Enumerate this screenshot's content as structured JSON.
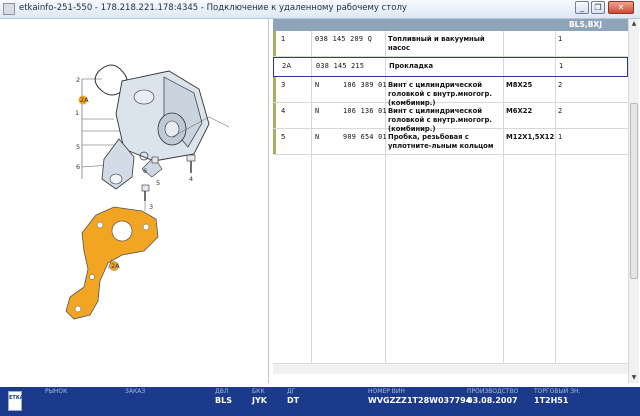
{
  "window": {
    "title": "etkainfo-251-550 - 178.218.221.178:4345 - Подключение к удаленному рабочему столу",
    "buttons": {
      "minimize": "_",
      "restore": "❐",
      "close": "✕"
    }
  },
  "illustration": {
    "callouts": [
      "1",
      "2",
      "2A",
      "3",
      "4",
      "5",
      "6"
    ]
  },
  "parts_table": {
    "header_right": "BLS,BXJ",
    "rows": [
      {
        "pos": "1",
        "mark": "",
        "part_number": "038 145 209 Q",
        "description": "Топливный и вакуумный насос",
        "spec": "",
        "qty": "1"
      },
      {
        "pos": "2A",
        "mark": "",
        "part_number": "038 145 215",
        "description": "Прокладка",
        "spec": "",
        "qty": "1"
      },
      {
        "pos": "3",
        "mark": "N",
        "part_number": "106 389 01",
        "description": "Винт с цилиндрической головкой с внутр.многогр. (комбинир.)",
        "spec": "M8X25",
        "qty": "2"
      },
      {
        "pos": "4",
        "mark": "N",
        "part_number": "106 136 01",
        "description": "Винт с цилиндрической головкой с внутр.многогр. (комбинир.)",
        "spec": "M6X22",
        "qty": "2"
      },
      {
        "pos": "5",
        "mark": "N",
        "part_number": "909 654 01",
        "description": "Пробка, резьбовая с уплотните-льным кольцом",
        "spec": "M12X1,5X12",
        "qty": "1"
      }
    ],
    "selected_row": "2A"
  },
  "status_bar": {
    "logo_text": "ETKA",
    "fields": [
      {
        "label": "РЫНОК",
        "value": ""
      },
      {
        "label": "ЗАКАЗ",
        "value": ""
      },
      {
        "label": "ДВЛ",
        "value": "BLS"
      },
      {
        "label": "БКК",
        "value": "JYK"
      },
      {
        "label": "ДГ",
        "value": "DT"
      },
      {
        "label": "НОМЕР ВИН",
        "value": "WVGZZZ1T28W037794"
      },
      {
        "label": "ПРОИЗВОДСТВО",
        "value": "03.08.2007"
      },
      {
        "label": "ТОРГОВЫЙ ЗН.",
        "value": "1T2H51"
      }
    ]
  },
  "colors": {
    "status_bg": "#1b3a8c",
    "table_header": "#8ea4b8",
    "row_accent": "#a8b060",
    "gasket_fill": "#f2a522",
    "selected_border": "#2f3a8a"
  }
}
